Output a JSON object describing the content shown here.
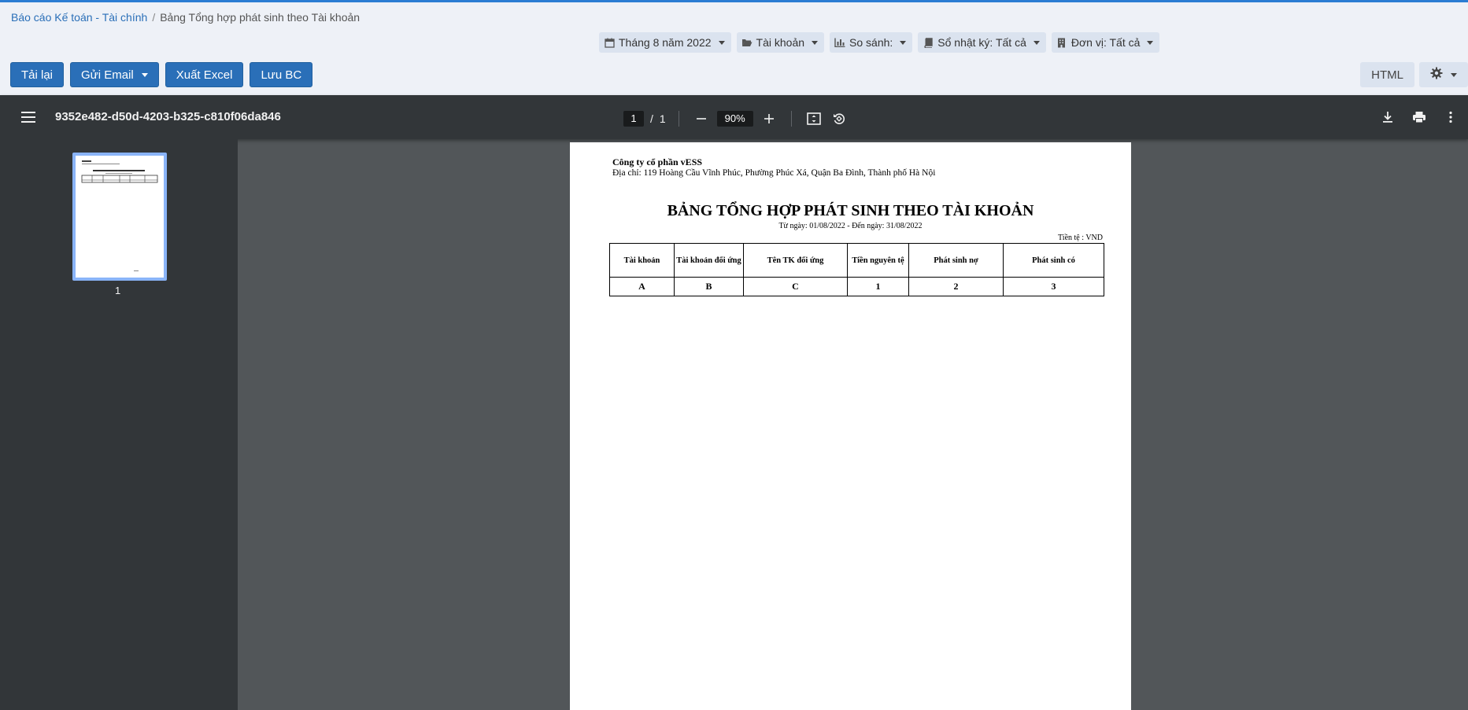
{
  "breadcrumb": {
    "parent": "Báo cáo Kế toán - Tài chính",
    "separator": "/",
    "current": "Bảng Tổng hợp phát sinh theo Tài khoản"
  },
  "filters": [
    {
      "icon": "calendar-icon",
      "label": "Tháng 8 năm 2022"
    },
    {
      "icon": "folder-open-icon",
      "label": "Tài khoản"
    },
    {
      "icon": "bar-chart-icon",
      "label": "So sánh:"
    },
    {
      "icon": "book-icon",
      "label": "Sổ nhật ký: Tất cả"
    },
    {
      "icon": "building-icon",
      "label": "Đơn vị: Tất cả"
    }
  ],
  "actions": {
    "reload": "Tải lại",
    "send_email": "Gửi Email",
    "export_excel": "Xuất Excel",
    "save_report": "Lưu BC",
    "html": "HTML"
  },
  "viewer": {
    "doc_title": "9352e482-d50d-4203-b325-c810f06da846",
    "page_current": "1",
    "page_sep": "/",
    "page_total": "1",
    "zoom": "90%",
    "thumb_label": "1"
  },
  "report": {
    "company": "Công ty cổ phần vESS",
    "address": "Địa chỉ: 119 Hoàng Cầu Vĩnh Phúc, Phường Phúc Xá, Quận Ba Đình, Thành phố Hà Nội",
    "title": "BẢNG TỔNG HỢP PHÁT SINH THEO TÀI KHOẢN",
    "date_range": "Từ ngày: 01/08/2022 - Đến ngày: 31/08/2022",
    "currency": "Tiền tệ : VND",
    "columns": [
      "Tài khoản",
      "Tài khoản đối ứng",
      "Tên TK đối ứng",
      "Tiền nguyên tệ",
      "Phát sinh nợ",
      "Phát sinh có"
    ],
    "codes": [
      "A",
      "B",
      "C",
      "1",
      "2",
      "3"
    ]
  },
  "colors": {
    "primary_button": "#2a6fb8",
    "viewer_toolbar": "#323639",
    "viewer_background": "#525659",
    "thumbnail_border": "#8ab4f8"
  }
}
